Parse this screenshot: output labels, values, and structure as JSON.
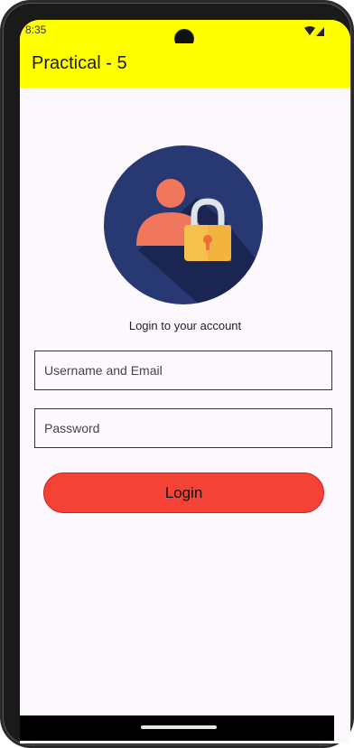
{
  "status_bar": {
    "time": "8:35",
    "wifi_icon": "wifi-icon",
    "signal_icon": "signal-icon"
  },
  "app_bar": {
    "title": "Practical - 5",
    "background_color": "#ffff00"
  },
  "login_form": {
    "logo_icon": "user-lock-icon",
    "subtitle": "Login to your account",
    "username_placeholder": "Username and Email",
    "password_placeholder": "Password",
    "login_label": "Login",
    "login_button_color": "#f44336"
  }
}
